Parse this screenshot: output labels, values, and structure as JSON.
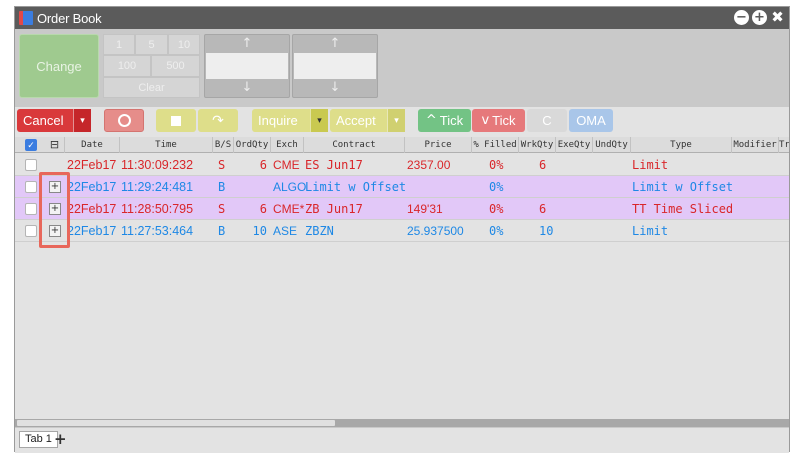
{
  "window": {
    "title": "Order Book"
  },
  "trade_panel": {
    "change_label": "Change",
    "qty_buttons": [
      "1",
      "5",
      "10",
      "100",
      "500"
    ],
    "clear_label": "Clear"
  },
  "toolbar": {
    "cancel_label": "Cancel",
    "inquire_label": "Inquire",
    "accept_label": "Accept",
    "tick_up_label": "Tick",
    "tick_down_label": "Tick",
    "refresh_label": "C",
    "oma_label": "OMA"
  },
  "columns": [
    "Date",
    "Time",
    "B/S",
    "OrdQty",
    "Exch",
    "Contract",
    "Price",
    "% Filled",
    "WrkQty",
    "ExeQty",
    "UndQty",
    "Type",
    "Modifier",
    "Tr"
  ],
  "orders": [
    {
      "date": "22Feb17",
      "time": "11:30:09:232",
      "bs": "S",
      "ordqty": "6",
      "exch": "CME",
      "contract": "ES Jun17",
      "price": "2357.00",
      "filled": "0%",
      "wrkqty": "6",
      "exeqty": "",
      "undqty": "",
      "type": "Limit",
      "bg": "#e3e3e3",
      "color": "#d9262a",
      "has_expander": false
    },
    {
      "date": "22Feb17",
      "time": "11:29:24:481",
      "bs": "B",
      "ordqty": "",
      "exch": "ALGO",
      "contract": "Limit w Offset",
      "price": "",
      "filled": "0%",
      "wrkqty": "",
      "exeqty": "",
      "undqty": "",
      "type": "Limit w Offset",
      "bg": "#e2c8f8",
      "color": "#1e88e5",
      "has_expander": true
    },
    {
      "date": "22Feb17",
      "time": "11:28:50:795",
      "bs": "S",
      "ordqty": "6",
      "exch": "CME*",
      "contract": "ZB Jun17",
      "price": "149'31",
      "filled": "0%",
      "wrkqty": "6",
      "exeqty": "",
      "undqty": "",
      "type": "TT Time Sliced",
      "bg": "#e2c8f8",
      "color": "#d9262a",
      "has_expander": true
    },
    {
      "date": "22Feb17",
      "time": "11:27:53:464",
      "bs": "B",
      "ordqty": "10",
      "exch": "ASE",
      "contract": "ZBZN",
      "price": "25.937500",
      "filled": "0%",
      "wrkqty": "10",
      "exeqty": "",
      "undqty": "",
      "type": "Limit",
      "bg": "#e3e3e3",
      "color": "#1e88e5",
      "has_expander": true
    }
  ],
  "tabs": [
    {
      "label": "Tab 1"
    }
  ],
  "tab_add_label": "+",
  "icons": {
    "minimize": "minus-circle-icon",
    "maximize": "plus-circle-icon",
    "close": "close-icon",
    "arrow_up": "↑",
    "arrow_down": "↓",
    "dropdown": "▾",
    "minus_box": "⊟",
    "expander": "+"
  }
}
